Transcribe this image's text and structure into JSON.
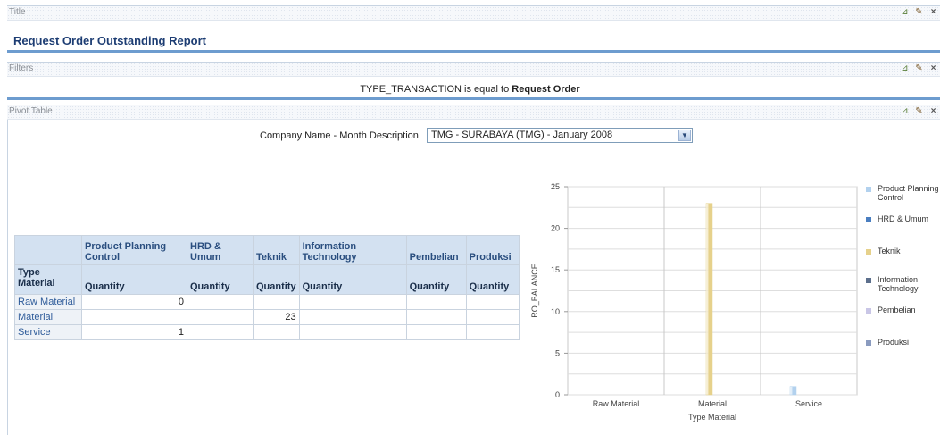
{
  "title_section": {
    "label": "Title",
    "report_title": "Request Order Outstanding Report"
  },
  "filters_section": {
    "label": "Filters",
    "filter_prefix": "TYPE_TRANSACTION is equal to ",
    "filter_value": "Request Order"
  },
  "pivot_section": {
    "label": "Pivot Table",
    "prompt_label": "Company Name - Month Description",
    "prompt_value": "TMG - SURABAYA (TMG) - January 2008"
  },
  "section_icons": [
    "edit-properties-icon",
    "edit-icon",
    "close-icon"
  ],
  "table": {
    "corner_label": "",
    "row_header": "Type Material",
    "columns": [
      "Product Planning Control",
      "HRD & Umum",
      "Teknik",
      "Information Technology",
      "Pembelian",
      "Produksi"
    ],
    "measure": "Quantity",
    "rows": [
      {
        "label": "Raw Material",
        "cells": [
          "0",
          "",
          "",
          "",
          "",
          ""
        ]
      },
      {
        "label": "Material",
        "cells": [
          "",
          "",
          "23",
          "",
          "",
          ""
        ]
      },
      {
        "label": "Service",
        "cells": [
          "1",
          "",
          "",
          "",
          "",
          ""
        ]
      }
    ]
  },
  "chart_data": {
    "type": "bar",
    "categories": [
      "Raw Material",
      "Material",
      "Service"
    ],
    "xlabel": "Type Material",
    "ylabel": "RO_BALANCE",
    "ylim": [
      0,
      25
    ],
    "yticks": [
      0,
      5,
      10,
      15,
      20,
      25
    ],
    "series": [
      {
        "name": "Product Planning Control",
        "color": "#b2d1ee",
        "values": [
          0,
          0,
          1
        ]
      },
      {
        "name": "HRD & Umum",
        "color": "#4a7ec0",
        "values": [
          0,
          0,
          0
        ]
      },
      {
        "name": "Teknik",
        "color": "#e6d18b",
        "values": [
          0,
          23,
          0
        ]
      },
      {
        "name": "Information Technology",
        "color": "#5c6f8c",
        "values": [
          0,
          0,
          0
        ]
      },
      {
        "name": "Pembelian",
        "color": "#c9c6e6",
        "values": [
          0,
          0,
          0
        ]
      },
      {
        "name": "Produksi",
        "color": "#8a9bbf",
        "values": [
          0,
          0,
          0
        ]
      }
    ],
    "legend": [
      "Product Planning Control",
      "HRD & Umum",
      "Teknik",
      "Information Technology",
      "Pembelian",
      "Produksi"
    ],
    "grid": true,
    "legend_position": "right"
  }
}
